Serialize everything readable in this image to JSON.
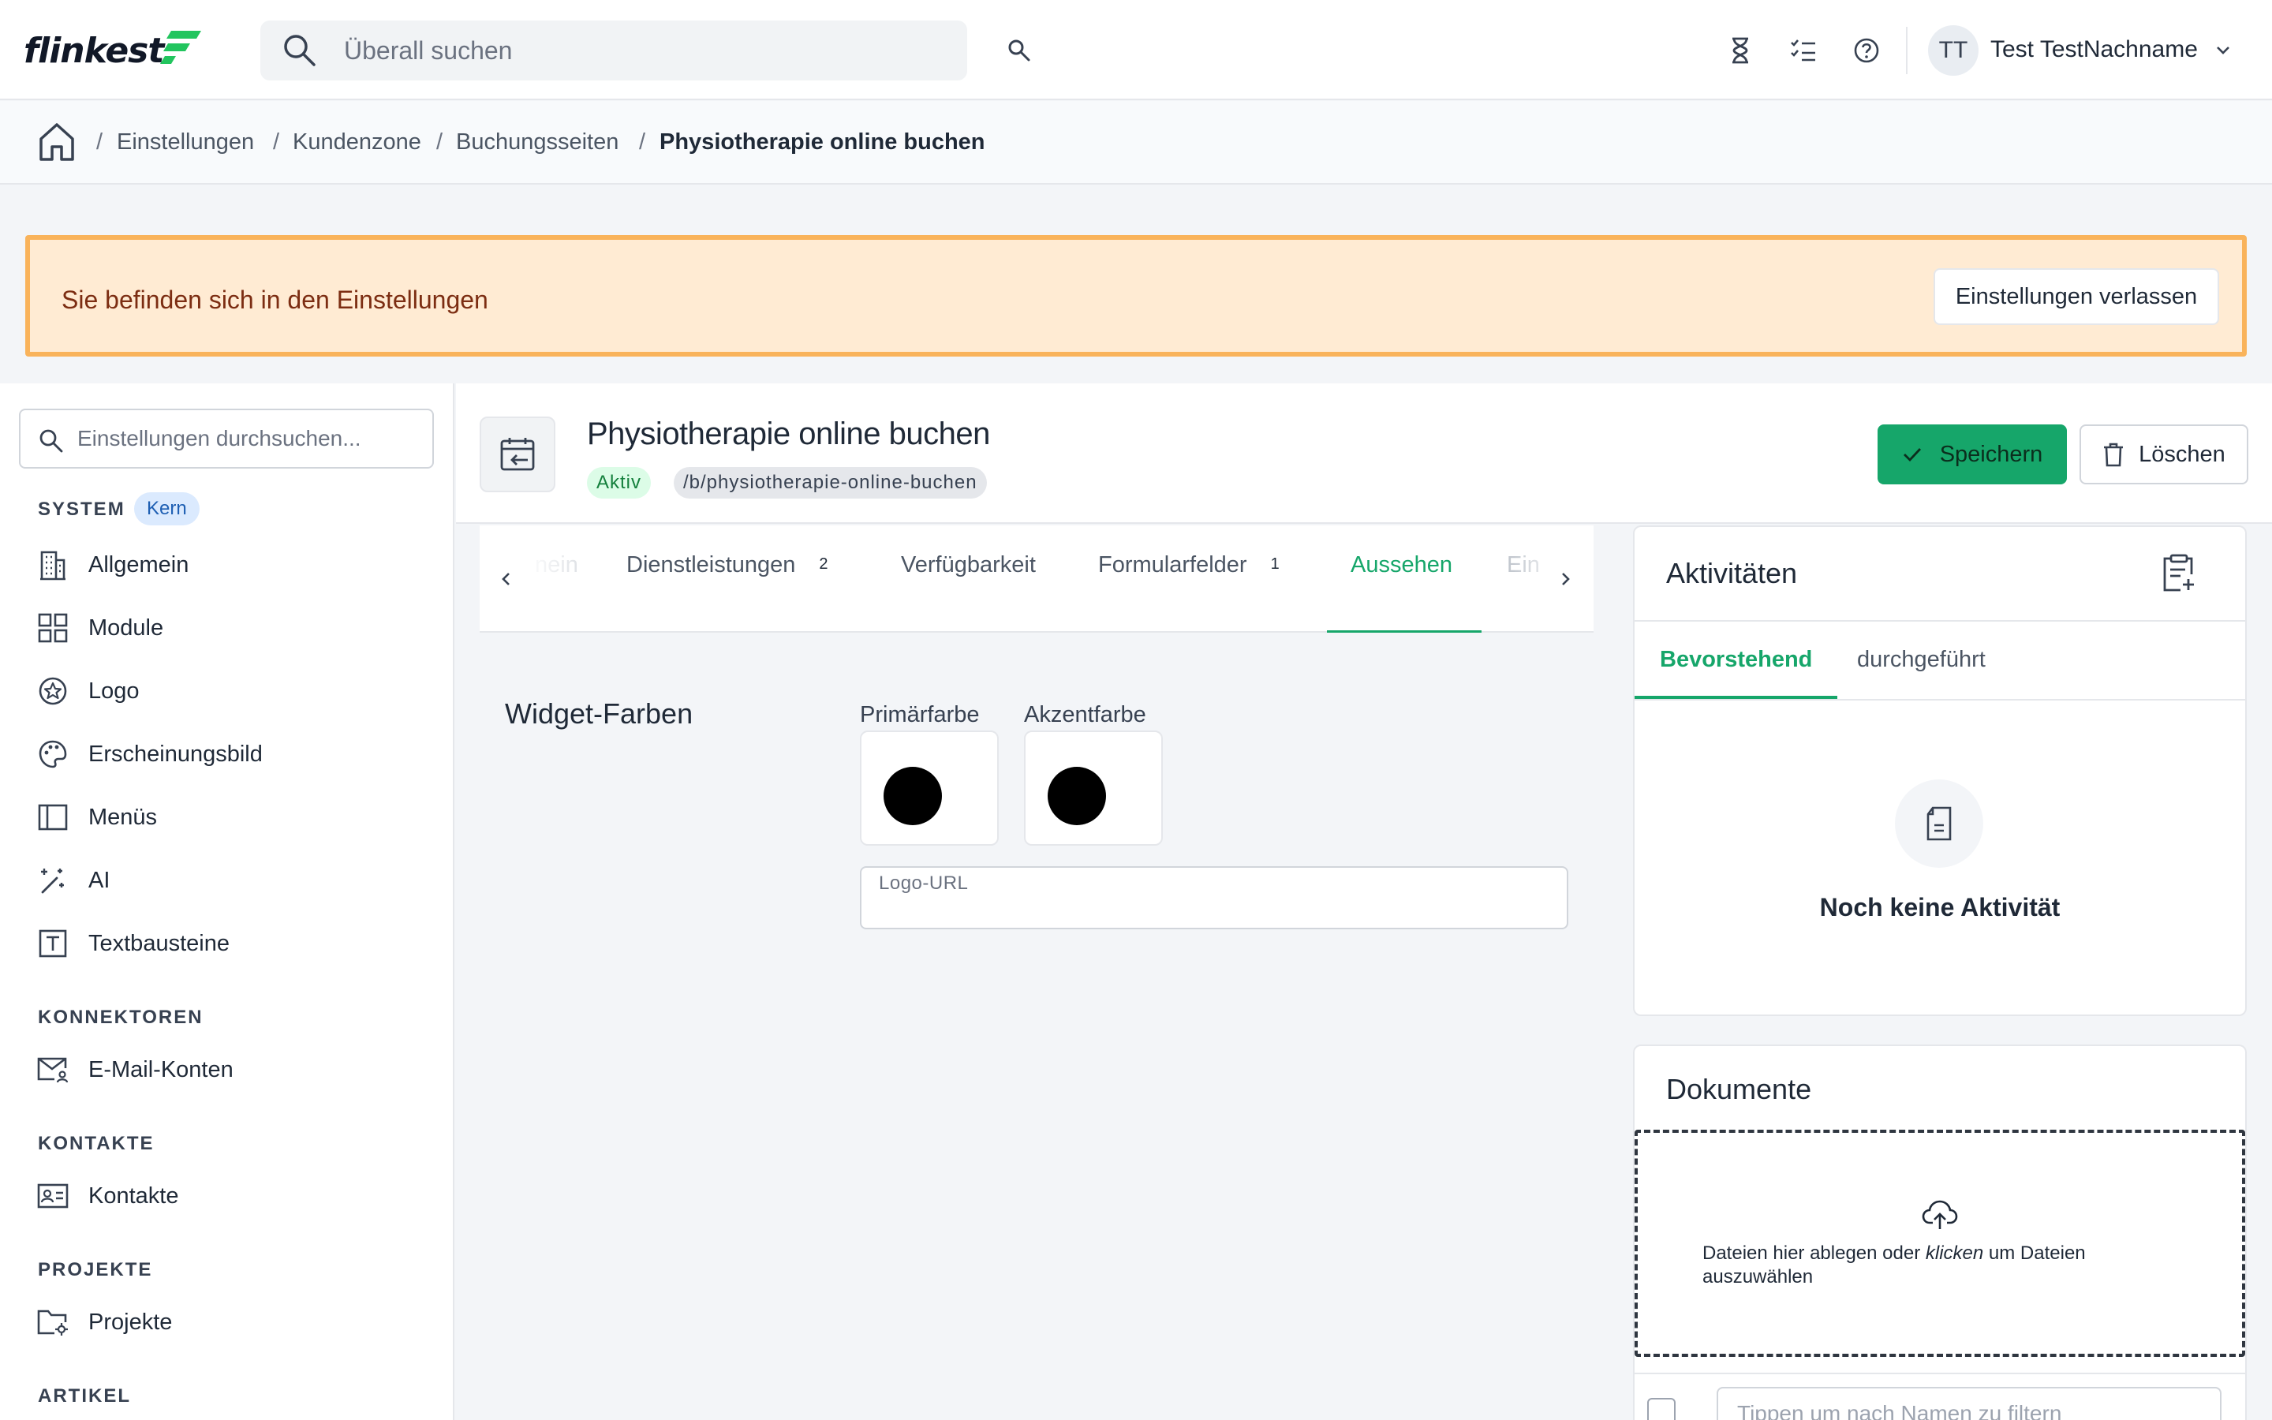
{
  "app": {
    "logo_text": "flinkest"
  },
  "topbar": {
    "search_placeholder": "Überall suchen",
    "user": {
      "initials": "TT",
      "name": "Test TestNachname"
    }
  },
  "breadcrumb": {
    "items": [
      "Einstellungen",
      "Kundenzone",
      "Buchungsseiten"
    ],
    "current": "Physiotherapie online buchen",
    "separator": "/"
  },
  "banner": {
    "text": "Sie befinden sich in den Einstellungen",
    "button_label": "Einstellungen verlassen"
  },
  "sidebar": {
    "search_placeholder": "Einstellungen durchsuchen...",
    "sections": [
      {
        "title": "SYSTEM",
        "badge": "Kern",
        "items": [
          "Allgemein",
          "Module",
          "Logo",
          "Erscheinungsbild",
          "Menüs",
          "AI",
          "Textbausteine"
        ]
      },
      {
        "title": "KONNEKTOREN",
        "items": [
          "E-Mail-Konten"
        ]
      },
      {
        "title": "KONTAKTE",
        "items": [
          "Kontakte"
        ]
      },
      {
        "title": "PROJEKTE",
        "items": [
          "Projekte"
        ]
      },
      {
        "title": "ARTIKEL",
        "items": []
      }
    ]
  },
  "page": {
    "title": "Physiotherapie online buchen",
    "status": "Aktiv",
    "slug": "/b/physiotherapie-online-buchen",
    "save_label": "Speichern",
    "delete_label": "Löschen"
  },
  "tabs": [
    {
      "label": "nein",
      "faded": true
    },
    {
      "label": "Dienstleistungen",
      "count": "2"
    },
    {
      "label": "Verfügbarkeit"
    },
    {
      "label": "Formularfelder",
      "count": "1"
    },
    {
      "label": "Aussehen",
      "active": true
    },
    {
      "label": "Ein",
      "faded": true
    }
  ],
  "appearance": {
    "section_title": "Widget-Farben",
    "primary_label": "Primärfarbe",
    "accent_label": "Akzentfarbe",
    "primary_color": "#000000",
    "accent_color": "#000000",
    "logo_url_label": "Logo-URL",
    "logo_url_value": ""
  },
  "activities": {
    "title": "Aktivitäten",
    "tabs": [
      "Bevorstehend",
      "durchgeführt"
    ],
    "active_tab": "Bevorstehend",
    "empty_text": "Noch keine Aktivität"
  },
  "documents": {
    "title": "Dokumente",
    "drop_text_before": "Dateien hier ablegen oder ",
    "drop_text_emphasis": "klicken",
    "drop_text_after": " um Dateien auszuwählen",
    "filter_placeholder": "Tippen um nach Namen zu filtern"
  },
  "colors": {
    "accent": "#16a66a",
    "banner_bg": "#ffebd3",
    "banner_border": "#f9b35b",
    "badge_bg": "#dbeafe"
  }
}
